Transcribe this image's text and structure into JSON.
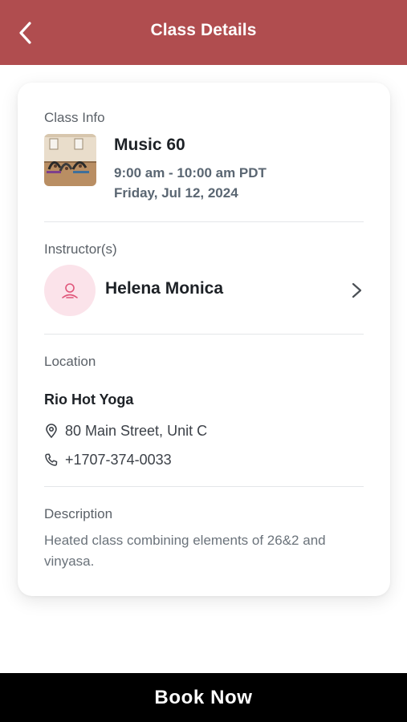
{
  "header": {
    "title": "Class Details",
    "back_icon": "chevron-left-icon",
    "background_color": "#b04d4f"
  },
  "class_info": {
    "label": "Class Info",
    "name": "Music 60",
    "time": "9:00 am - 10:00 am PDT",
    "date": "Friday, Jul 12, 2024"
  },
  "instructor": {
    "label": "Instructor(s)",
    "name": "Helena Monica",
    "avatar_icon": "user-icon",
    "avatar_bg": "#fbe3ea"
  },
  "location": {
    "label": "Location",
    "name": "Rio Hot Yoga",
    "address": "80 Main Street, Unit C",
    "phone": "+1707-374-0033"
  },
  "description": {
    "label": "Description",
    "text": "Heated class combining elements of 26&2 and vinyasa."
  },
  "footer": {
    "book_label": "Book Now",
    "background_color": "#000000"
  }
}
